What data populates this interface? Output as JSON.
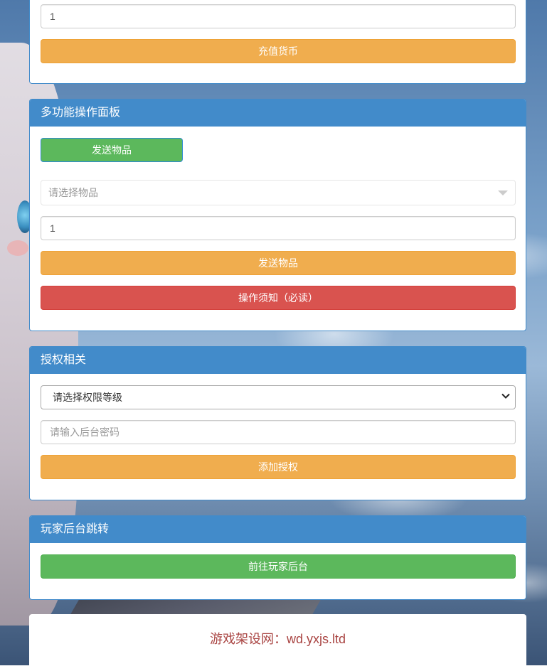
{
  "recharge_panel": {
    "amount_value": "1",
    "recharge_button": "充值货币"
  },
  "multi_panel": {
    "title": "多功能操作面板",
    "send_item_top_button": "发送物品",
    "item_select_placeholder": "请选择物品",
    "quantity_value": "1",
    "send_item_button": "发送物品",
    "notice_button": "操作须知（必读）"
  },
  "auth_panel": {
    "title": "授权相关",
    "level_select_value": "请选择权限等级",
    "password_placeholder": "请输入后台密码",
    "add_auth_button": "添加授权"
  },
  "player_panel": {
    "title": "玩家后台跳转",
    "goto_button": "前往玩家后台"
  },
  "footer": {
    "site_text": "游戏架设网：wd.yxjs.ltd"
  },
  "colors": {
    "primary": "#428bca",
    "warning": "#f0ad4e",
    "success": "#5cb85c",
    "danger": "#d9534f",
    "footer_text": "#a94442"
  }
}
